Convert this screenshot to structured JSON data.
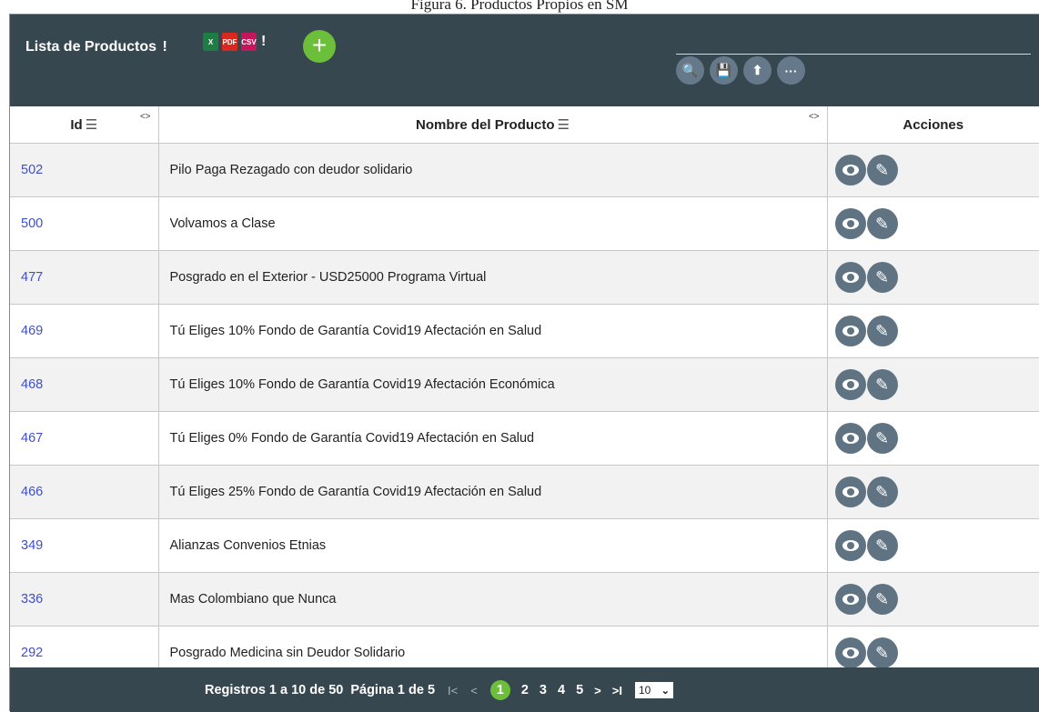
{
  "caption": "Figura 6. Productos Propios en SM",
  "header": {
    "title": "Lista de Productos",
    "separator": "!",
    "export_icons": [
      {
        "name": "excel-export-icon",
        "glyph": "X"
      },
      {
        "name": "pdf-export-icon",
        "glyph": "PDF"
      },
      {
        "name": "csv-export-icon",
        "glyph": "CSV"
      }
    ],
    "add_icon": "+",
    "tools": [
      {
        "name": "search-icon",
        "glyph": "🔍"
      },
      {
        "name": "save-icon",
        "glyph": "💾"
      },
      {
        "name": "upload-icon",
        "glyph": "⬆"
      },
      {
        "name": "more-icon",
        "glyph": "···"
      }
    ]
  },
  "table": {
    "columns": [
      "Id",
      "Nombre del Producto",
      "Acciones"
    ],
    "sort_icon": "☰",
    "resize_icon": "<>",
    "rows": [
      {
        "id": "502",
        "name": "Pilo Paga Rezagado con deudor solidario"
      },
      {
        "id": "500",
        "name": "Volvamos a Clase"
      },
      {
        "id": "477",
        "name": "Posgrado en el Exterior - USD25000 Programa Virtual"
      },
      {
        "id": "469",
        "name": "Tú Eliges 10% Fondo de Garantía Covid19 Afectación en Salud"
      },
      {
        "id": "468",
        "name": "Tú Eliges 10% Fondo de Garantía Covid19 Afectación Económica"
      },
      {
        "id": "467",
        "name": "Tú Eliges 0% Fondo de Garantía Covid19 Afectación en Salud"
      },
      {
        "id": "466",
        "name": "Tú Eliges 25% Fondo de Garantía Covid19 Afectación en Salud"
      },
      {
        "id": "349",
        "name": "Alianzas Convenios Etnias"
      },
      {
        "id": "336",
        "name": "Mas Colombiano que Nunca"
      },
      {
        "id": "292",
        "name": "Posgrado Medicina sin Deudor Solidario"
      }
    ]
  },
  "footer": {
    "records": "Registros 1 a 10 de 50",
    "page": "Página 1 de 5",
    "first": "I<",
    "prev": "<",
    "pages": [
      "1",
      "2",
      "3",
      "4",
      "5"
    ],
    "next": ">",
    "last": ">I",
    "page_size": "10"
  },
  "colors": {
    "header_bg": "#37474f",
    "accent_green": "#6cbf3a",
    "id_link": "#3f4fc9",
    "action_button": "#5f7382"
  }
}
